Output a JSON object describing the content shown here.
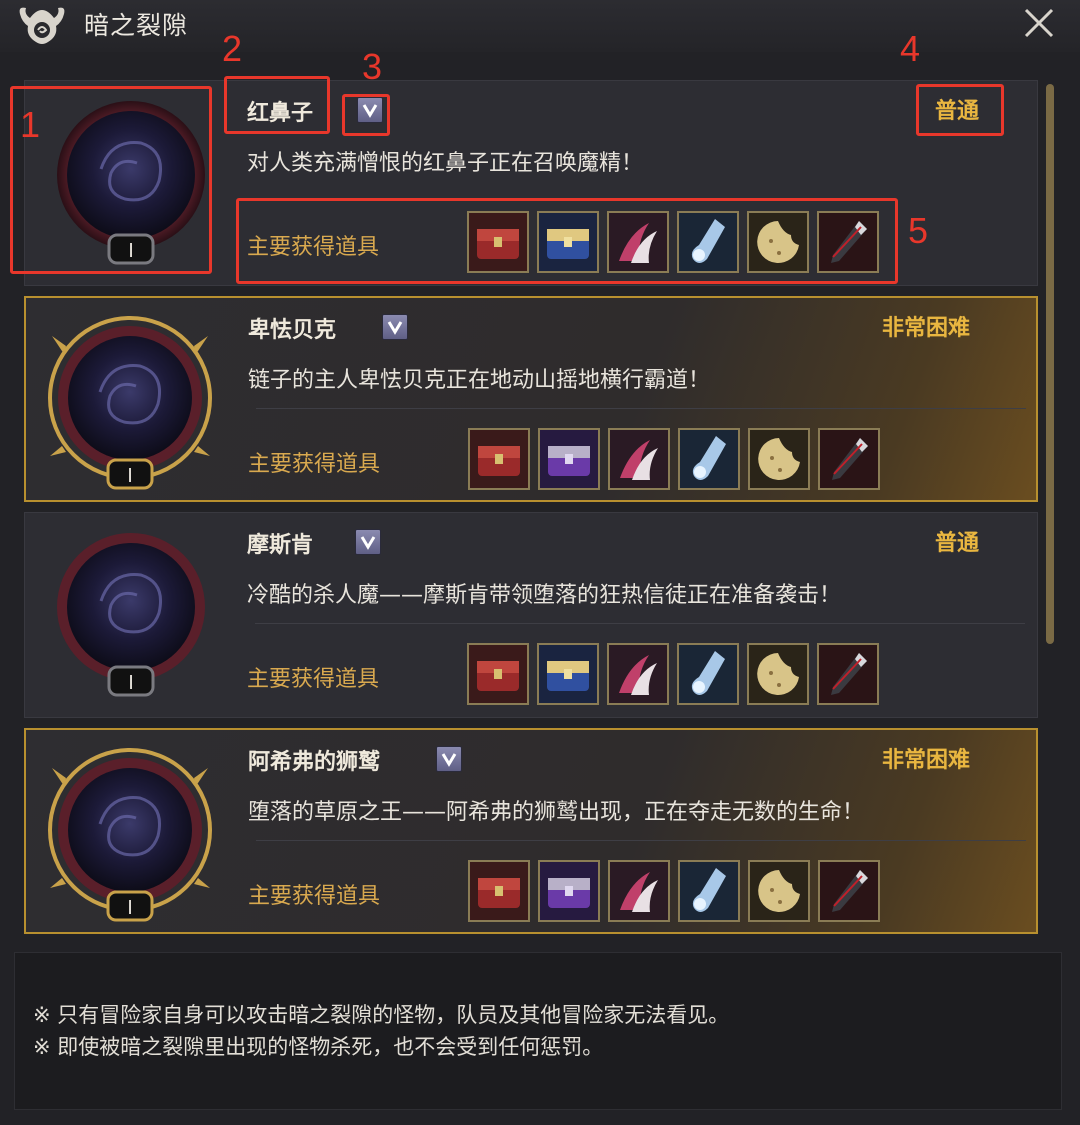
{
  "window": {
    "title": "暗之裂隙",
    "close_icon": "close-icon"
  },
  "colors": {
    "difficulty_normal": "#e9b640",
    "difficulty_hard": "#e9b640",
    "item_label": "#d9a94f",
    "annotation": "#e8372b",
    "hard_border": "#b8902f"
  },
  "entries": [
    {
      "name": "红鼻子",
      "difficulty": "普通",
      "description": "对人类充满憎恨的红鼻子正在召唤魔精！",
      "items_label": "主要获得道具",
      "badge": "I",
      "hard": false,
      "items": [
        "red-chest-icon",
        "blue-chest-icon",
        "claw-icon",
        "potion-icon",
        "cookie-icon",
        "dagger-icon"
      ]
    },
    {
      "name": "卑怯贝克",
      "difficulty": "非常困难",
      "description": "链子的主人卑怯贝克正在地动山摇地横行霸道！",
      "items_label": "主要获得道具",
      "badge": "I",
      "hard": true,
      "items": [
        "red-chest-icon",
        "purple-chest-icon",
        "claw-icon",
        "potion-icon",
        "cookie-icon",
        "dagger-icon"
      ]
    },
    {
      "name": "摩斯肯",
      "difficulty": "普通",
      "description": "冷酷的杀人魔——摩斯肯带领堕落的狂热信徒正在准备袭击！",
      "items_label": "主要获得道具",
      "badge": "I",
      "hard": false,
      "items": [
        "red-chest-icon",
        "blue-chest-icon",
        "claw-icon",
        "potion-icon",
        "cookie-icon",
        "dagger-icon"
      ]
    },
    {
      "name": "阿希弗的狮鹫",
      "difficulty": "非常困难",
      "description": "堕落的草原之王——阿希弗的狮鹫出现，正在夺走无数的生命！",
      "items_label": "主要获得道具",
      "badge": "I",
      "hard": true,
      "items": [
        "red-chest-icon",
        "purple-chest-icon",
        "claw-icon",
        "potion-icon",
        "cookie-icon",
        "dagger-icon"
      ]
    }
  ],
  "notes": [
    "※ 只有冒险家自身可以攻击暗之裂隙的怪物，队员及其他冒险家无法看见。",
    "※ 即使被暗之裂隙里出现的怪物杀死，也不会受到任何惩罚。"
  ],
  "annotations": [
    "1",
    "2",
    "3",
    "4",
    "5"
  ]
}
